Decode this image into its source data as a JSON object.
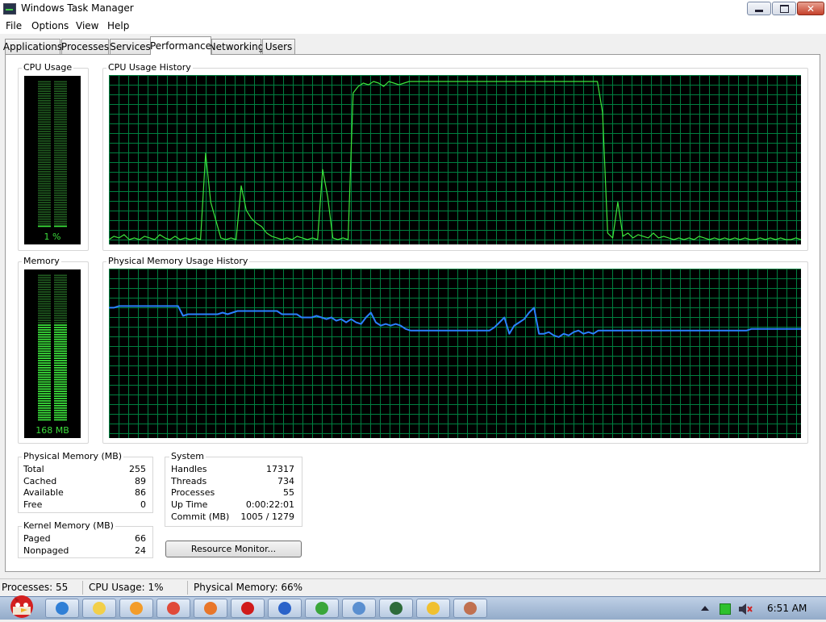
{
  "window": {
    "title": "Windows Task Manager",
    "minimize_label": "minimize",
    "restore_label": "restore",
    "close_glyph": "✕"
  },
  "menu": [
    "File",
    "Options",
    "View",
    "Help"
  ],
  "tabs": [
    {
      "label": "Applications",
      "active": false
    },
    {
      "label": "Processes",
      "active": false
    },
    {
      "label": "Services",
      "active": false
    },
    {
      "label": "Performance",
      "active": true
    },
    {
      "label": "Networking",
      "active": false
    },
    {
      "label": "Users",
      "active": false
    }
  ],
  "cpu": {
    "usage_label": "CPU Usage",
    "usage_value": "1 %",
    "history_label": "CPU Usage History",
    "usage_level": 0.01,
    "history": [
      2,
      4,
      3,
      5,
      2,
      3,
      2,
      4,
      3,
      2,
      5,
      3,
      2,
      4,
      2,
      3,
      2,
      3,
      2,
      55,
      25,
      14,
      3,
      2,
      3,
      2,
      35,
      20,
      15,
      12,
      10,
      6,
      4,
      3,
      2,
      3,
      2,
      4,
      3,
      2,
      3,
      2,
      45,
      28,
      3,
      2,
      3,
      2,
      92,
      96,
      98,
      97,
      99,
      98,
      96,
      99,
      98,
      97,
      98,
      99,
      99,
      99,
      99,
      99,
      99,
      99,
      99,
      99,
      99,
      99,
      99,
      99,
      99,
      99,
      99,
      99,
      99,
      99,
      99,
      99,
      99,
      99,
      99,
      99,
      99,
      99,
      99,
      99,
      99,
      99,
      99,
      99,
      99,
      99,
      99,
      99,
      99,
      80,
      6,
      3,
      25,
      4,
      6,
      3,
      5,
      4,
      3,
      6,
      3,
      4,
      3,
      2,
      3,
      2,
      3,
      2,
      4,
      3,
      2,
      3,
      2,
      3,
      2,
      3,
      2,
      3,
      2,
      2,
      3,
      2,
      3,
      2,
      3,
      2,
      2,
      3,
      2
    ]
  },
  "memory": {
    "usage_label": "Memory",
    "usage_value": "168 MB",
    "history_label": "Physical Memory Usage History",
    "usage_level": 0.66,
    "history": [
      79,
      79,
      80,
      80,
      80,
      80,
      80,
      80,
      80,
      80,
      80,
      80,
      80,
      80,
      80,
      74,
      75,
      75,
      75,
      75,
      75,
      75,
      75,
      76,
      75,
      76,
      77,
      77,
      77,
      77,
      77,
      77,
      77,
      77,
      77,
      75,
      75,
      75,
      75,
      73,
      73,
      73,
      74,
      73,
      72,
      73,
      71,
      72,
      70,
      72,
      70,
      69,
      73,
      76,
      70,
      68,
      69,
      68,
      69,
      68,
      66,
      65,
      65,
      65,
      65,
      65,
      65,
      65,
      65,
      65,
      65,
      65,
      65,
      65,
      65,
      65,
      65,
      65,
      67,
      70,
      73,
      63,
      68,
      70,
      72,
      76,
      79,
      63,
      63,
      64,
      62,
      61,
      63,
      62,
      64,
      65,
      63,
      64,
      63,
      65,
      65,
      65,
      65,
      65,
      65,
      65,
      65,
      65,
      65,
      65,
      65,
      65,
      65,
      65,
      65,
      65,
      65,
      65,
      65,
      65,
      65,
      65,
      65,
      65,
      65,
      65,
      65,
      65,
      65,
      65,
      66,
      66,
      66,
      66,
      66,
      66,
      66,
      66,
      66,
      66,
      66
    ]
  },
  "physical_memory": {
    "title": "Physical Memory (MB)",
    "rows": [
      {
        "k": "Total",
        "v": "255"
      },
      {
        "k": "Cached",
        "v": "89"
      },
      {
        "k": "Available",
        "v": "86"
      },
      {
        "k": "Free",
        "v": "0"
      }
    ]
  },
  "kernel_memory": {
    "title": "Kernel Memory (MB)",
    "rows": [
      {
        "k": "Paged",
        "v": "66"
      },
      {
        "k": "Nonpaged",
        "v": "24"
      }
    ]
  },
  "system": {
    "title": "System",
    "rows": [
      {
        "k": "Handles",
        "v": "17317"
      },
      {
        "k": "Threads",
        "v": "734"
      },
      {
        "k": "Processes",
        "v": "55"
      },
      {
        "k": "Up Time",
        "v": "0:00:22:01"
      },
      {
        "k": "Commit (MB)",
        "v": "1005 / 1279"
      }
    ]
  },
  "resource_monitor_label": "Resource Monitor...",
  "status": {
    "processes": "Processes: 55",
    "cpu": "CPU Usage: 1%",
    "memory": "Physical Memory: 66%"
  },
  "colors": {
    "cpu_line": "#3ce63c",
    "mem_line": "#2a7fff",
    "grid": "#008040",
    "meter_on": "#3ce63c",
    "meter_off": "#1f5a1f"
  },
  "taskbar": {
    "clock": "6:51 AM",
    "buttons": [
      {
        "name": "ie-icon",
        "color": "#2f7fd6"
      },
      {
        "name": "folder-icon",
        "color": "#f2cf4a"
      },
      {
        "name": "media-player-icon",
        "color": "#f39c2a"
      },
      {
        "name": "chrome-icon",
        "color": "#e04a3a"
      },
      {
        "name": "firefox-icon",
        "color": "#e8762a"
      },
      {
        "name": "opera-icon",
        "color": "#d01b1b"
      },
      {
        "name": "office-icon",
        "color": "#2a62c9"
      },
      {
        "name": "utorrent-icon",
        "color": "#3aa63a"
      },
      {
        "name": "chat-icon",
        "color": "#5a8fd0"
      },
      {
        "name": "task-manager-icon",
        "color": "#2e6b3a"
      },
      {
        "name": "messenger-icon",
        "color": "#f0c030"
      },
      {
        "name": "tools-icon",
        "color": "#c07050"
      }
    ]
  }
}
